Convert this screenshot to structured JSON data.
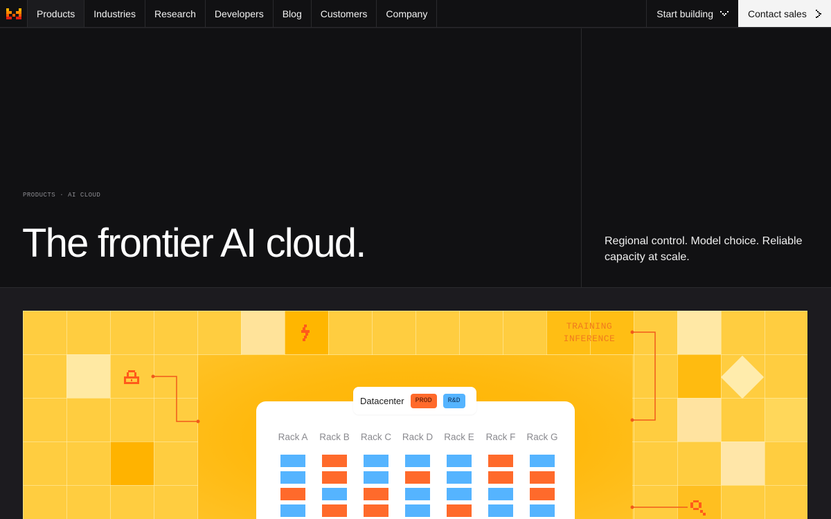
{
  "nav": {
    "items": [
      {
        "label": "Products",
        "active": true
      },
      {
        "label": "Industries",
        "active": false
      },
      {
        "label": "Research",
        "active": false
      },
      {
        "label": "Developers",
        "active": false
      },
      {
        "label": "Blog",
        "active": false
      },
      {
        "label": "Customers",
        "active": false
      },
      {
        "label": "Company",
        "active": false
      }
    ],
    "start_building": "Start building",
    "contact_sales": "Contact sales"
  },
  "hero": {
    "breadcrumb": [
      "PRODUCTS",
      "AI CLOUD"
    ],
    "breadcrumb_sep": "·",
    "headline": "The frontier AI cloud.",
    "tagline": "Regional control. Model choice. Reliable capacity at scale."
  },
  "illustration": {
    "tag_lines": [
      "TRAINING",
      "INFERENCE"
    ],
    "datacenter_label": "Datacenter",
    "badges": [
      {
        "label": "PROD",
        "color": "#ff6a2b"
      },
      {
        "label": "R&D",
        "color": "#55b4ff"
      }
    ],
    "racks": [
      {
        "name": "Rack A",
        "cells": [
          "blue",
          "blue",
          "orange",
          "blue"
        ]
      },
      {
        "name": "Rack B",
        "cells": [
          "orange",
          "orange",
          "blue",
          "orange"
        ]
      },
      {
        "name": "Rack C",
        "cells": [
          "blue",
          "blue",
          "orange",
          "orange"
        ]
      },
      {
        "name": "Rack D",
        "cells": [
          "blue",
          "orange",
          "blue",
          "blue"
        ]
      },
      {
        "name": "Rack E",
        "cells": [
          "blue",
          "blue",
          "blue",
          "orange"
        ]
      },
      {
        "name": "Rack F",
        "cells": [
          "orange",
          "orange",
          "blue",
          "blue"
        ]
      },
      {
        "name": "Rack G",
        "cells": [
          "blue",
          "orange",
          "orange",
          "blue"
        ]
      }
    ],
    "icons": [
      "lightning-icon",
      "lock-icon",
      "magnifier-icon"
    ]
  },
  "colors": {
    "brand_orange": "#ff6a2b",
    "accent_blue": "#55b4ff",
    "hero_bg": "#111113",
    "illustration_yellow": "#ffcd40"
  }
}
